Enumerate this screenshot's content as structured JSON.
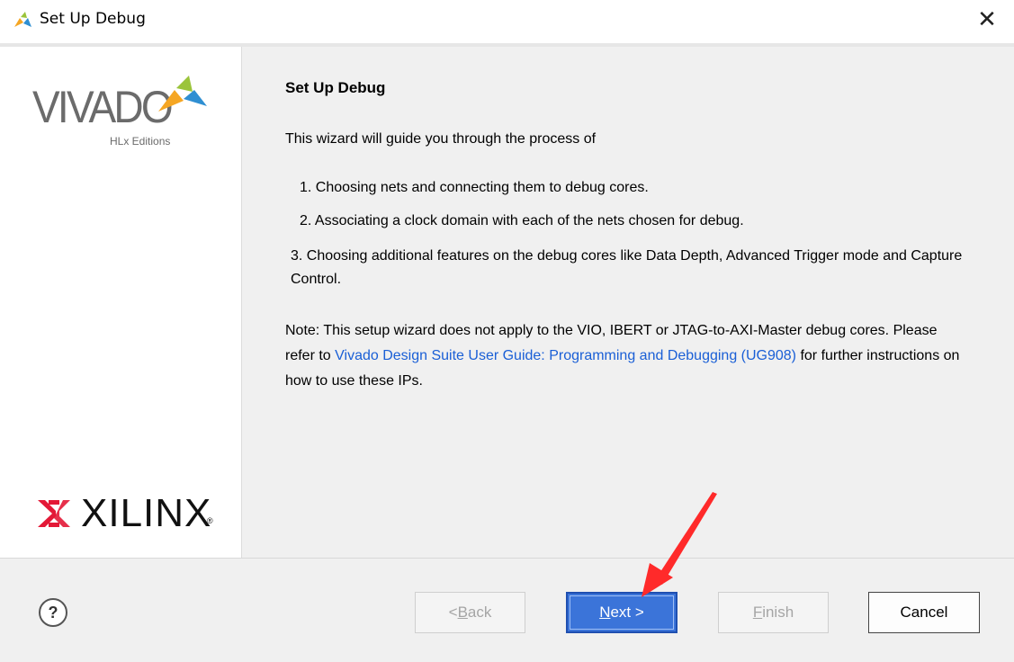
{
  "window": {
    "title": "Set Up Debug",
    "close_symbol": "✕"
  },
  "logos": {
    "vivado": "VIVADO",
    "vivado_sub": "HLx Editions",
    "xilinx": "XILINX",
    "xilinx_reg": "®"
  },
  "content": {
    "heading": "Set Up Debug",
    "intro": "This wizard will guide you through the process of",
    "steps": [
      "1.  Choosing nets and connecting them to debug cores.",
      "2.  Associating a clock domain with each of the nets chosen for debug.",
      "3.  Choosing additional features on the debug cores like Data Depth, Advanced Trigger mode and Capture Control."
    ],
    "note_prefix": "Note: This setup wizard does not apply to the VIO, IBERT or JTAG-to-AXI-Master debug cores. Please refer to ",
    "note_link": "Vivado Design Suite User Guide: Programming and Debugging (UG908)",
    "note_suffix": " for further instructions on how to use these IPs."
  },
  "buttons": {
    "help": "?",
    "back_prefix": "< ",
    "back_key": "B",
    "back_rest": "ack",
    "next_key": "N",
    "next_rest": "ext >",
    "finish_key": "F",
    "finish_rest": "inish",
    "cancel": "Cancel"
  },
  "colors": {
    "link": "#1a5fd6",
    "primary_button": "#3b74d9",
    "annotation_arrow": "#ff2a2a",
    "vivado_leaf": "#f5a623",
    "xilinx_red": "#e31937"
  },
  "icons": [
    "vivado-app-icon",
    "close-icon",
    "help-icon",
    "vivado-logo",
    "xilinx-logo",
    "red-annotation-arrow"
  ]
}
